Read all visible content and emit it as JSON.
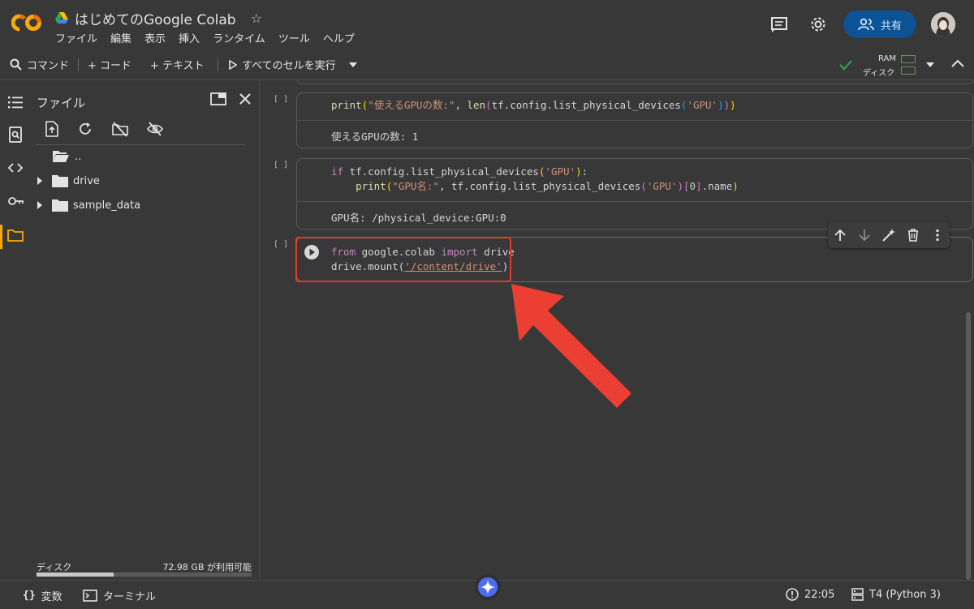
{
  "header": {
    "title": "はじめてのGoogle Colab",
    "star": "☆",
    "menu": [
      "ファイル",
      "編集",
      "表示",
      "挿入",
      "ランタイム",
      "ツール",
      "ヘルプ"
    ],
    "share_label": "共有"
  },
  "toolbar": {
    "command_label": "コマンド",
    "code_label": "+ コード",
    "text_label": "+ テキスト",
    "run_all_label": "すべてのセルを実行",
    "ram_label": "RAM",
    "disk_label": "ディスク"
  },
  "files": {
    "title": "ファイル",
    "tree": [
      {
        "name": ".."
      },
      {
        "name": "drive"
      },
      {
        "name": "sample_data"
      }
    ],
    "disk_label": "ディスク",
    "disk_free": "72.98 GB が利用可能",
    "disk_used_fraction": 0.36
  },
  "cells": [
    {
      "bracket": "[ ]",
      "code": "print(\"使えるGPUの数:\", len(tf.config.list_physical_devices('GPU')))",
      "output": "使えるGPUの数: 1"
    },
    {
      "bracket": "[ ]",
      "code_lines": [
        "if tf.config.list_physical_devices('GPU'):",
        "    print(\"GPU名:\", tf.config.list_physical_devices('GPU')[0].name)"
      ],
      "output": "GPU名: /physical_device:GPU:0"
    },
    {
      "bracket": "[ ]",
      "code_line1": {
        "kw_from": "from",
        "module": "google.colab",
        "kw_import": "import",
        "name": "drive"
      },
      "code_line2": {
        "call": "drive.mount(",
        "arg": "'/content/drive'",
        "close": ")"
      }
    }
  ],
  "status": {
    "variables_label": "変数",
    "terminal_label": "ターミナル",
    "time": "22:05",
    "runtime": "T4 (Python 3)"
  },
  "colors": {
    "accent_orange": "#f9ab00",
    "share_bg": "#0b5394",
    "highlight_red": "#e43a2c"
  }
}
